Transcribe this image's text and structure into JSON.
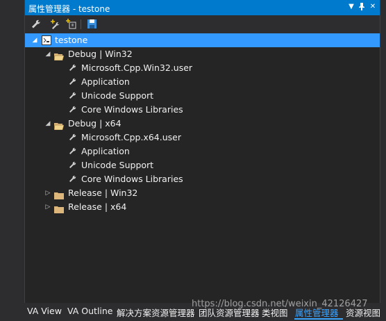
{
  "panel": {
    "title": "属性管理器 - testone",
    "pin_icon": "pin-icon",
    "close_icon": "close-icon",
    "dropdown_icon": "dropdown-icon"
  },
  "toolbar": {
    "items": [
      "wrench-icon",
      "add-property-icon",
      "add-sheet-icon",
      "save-icon"
    ]
  },
  "tree": {
    "root": "testone",
    "groups": [
      {
        "label": "Debug | Win32",
        "expanded": true,
        "items": [
          "Microsoft.Cpp.Win32.user",
          "Application",
          "Unicode Support",
          "Core Windows Libraries"
        ]
      },
      {
        "label": "Debug | x64",
        "expanded": true,
        "items": [
          "Microsoft.Cpp.x64.user",
          "Application",
          "Unicode Support",
          "Core Windows Libraries"
        ]
      },
      {
        "label": "Release | Win32",
        "expanded": false,
        "items": []
      },
      {
        "label": "Release | x64",
        "expanded": false,
        "items": []
      }
    ]
  },
  "bottom_tabs": [
    "VA View",
    "VA Outline",
    "解决方案资源管理器",
    "团队资源管理器",
    "类视图",
    "属性管理器",
    "资源视图"
  ],
  "active_tab": "属性管理器",
  "watermark": "https://blog.csdn.net/weixin_42126427",
  "colors": {
    "accent": "#007acc",
    "selected": "#3399ff",
    "panel_bg": "#252526"
  }
}
